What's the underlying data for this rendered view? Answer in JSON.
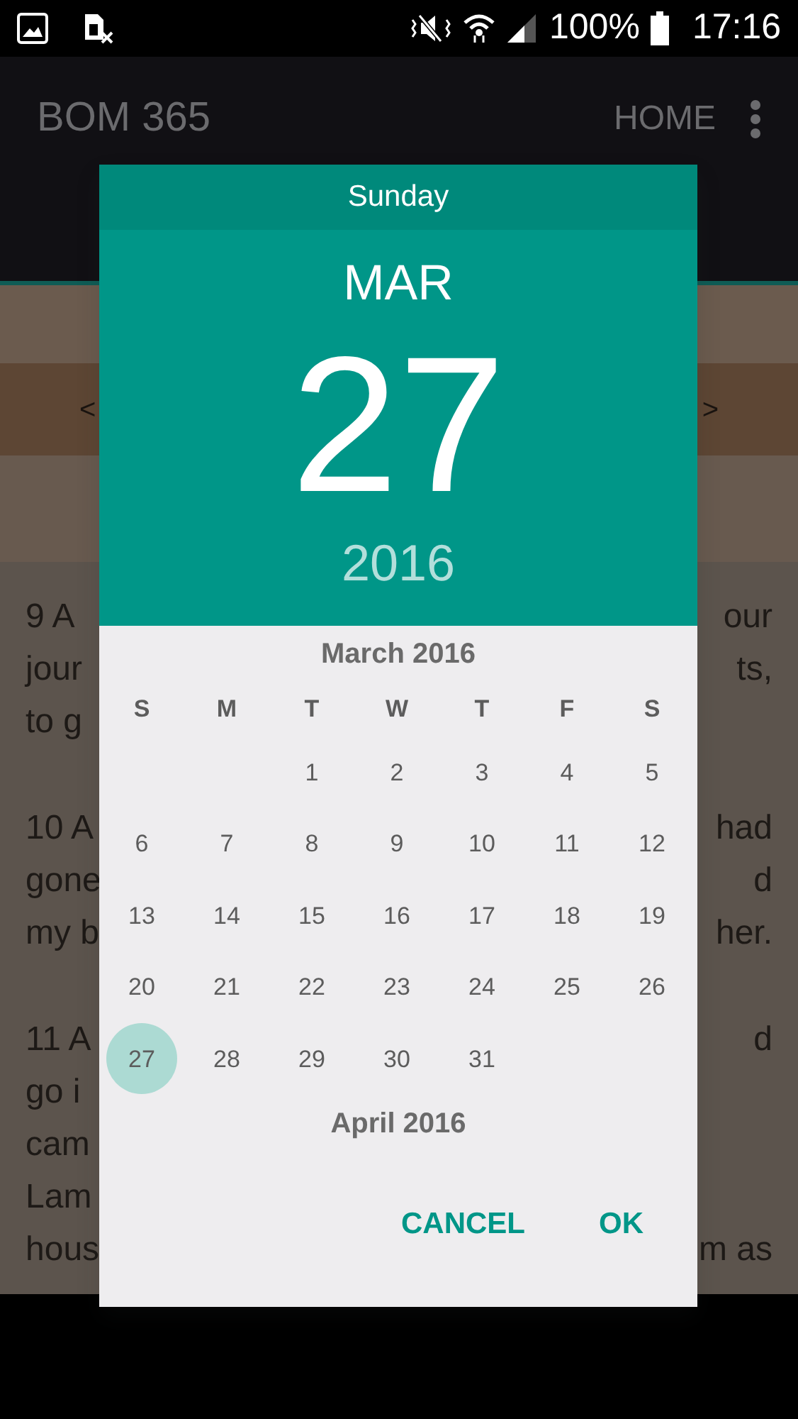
{
  "status_bar": {
    "battery": "100%",
    "time": "17:16"
  },
  "app_bar": {
    "title": "BOM 365",
    "action": "HOME"
  },
  "chapter_nav": {
    "previous": "<",
    "next": ">"
  },
  "background_text": [
    {
      "lines": [
        {
          "left": "9 A",
          "right": "our"
        },
        {
          "left": "jour",
          "right": "ts,"
        },
        {
          "left": "to g"
        }
      ]
    },
    {
      "lines": [
        {
          "left": "10 A",
          "right": "had"
        },
        {
          "left": "gone",
          "right": "d"
        },
        {
          "left": "my b",
          "right": "her."
        }
      ]
    },
    {
      "lines": [
        {
          "left": "11 A",
          "right": "d"
        },
        {
          "left": "go i"
        },
        {
          "left": "cam"
        },
        {
          "left": "Lam"
        },
        {
          "left": "hous",
          "right": "m as"
        }
      ]
    }
  ],
  "date_picker": {
    "weekday": "Sunday",
    "month": "MAR",
    "day": "27",
    "year": "2016",
    "months": [
      {
        "title": "March 2016",
        "weekdays": [
          "S",
          "M",
          "T",
          "W",
          "T",
          "F",
          "S"
        ],
        "weeks": [
          [
            {
              "label": "1",
              "selected": false
            },
            {
              "label": "2",
              "selected": false
            },
            {
              "label": "3",
              "selected": false
            },
            {
              "label": "4",
              "selected": false
            },
            {
              "label": "5",
              "selected": false
            }
          ],
          [
            {
              "label": "6",
              "selected": false
            },
            {
              "label": "7",
              "selected": false
            },
            {
              "label": "8",
              "selected": false
            },
            {
              "label": "9",
              "selected": false
            },
            {
              "label": "10",
              "selected": false
            },
            {
              "label": "11",
              "selected": false
            },
            {
              "label": "12",
              "selected": false
            }
          ],
          [
            {
              "label": "13",
              "selected": false
            },
            {
              "label": "14",
              "selected": false
            },
            {
              "label": "15",
              "selected": false
            },
            {
              "label": "16",
              "selected": false
            },
            {
              "label": "17",
              "selected": false
            },
            {
              "label": "18",
              "selected": false
            },
            {
              "label": "19",
              "selected": false
            }
          ],
          [
            {
              "label": "20",
              "selected": false
            },
            {
              "label": "21",
              "selected": false
            },
            {
              "label": "22",
              "selected": false
            },
            {
              "label": "23",
              "selected": false
            },
            {
              "label": "24",
              "selected": false
            },
            {
              "label": "25",
              "selected": false
            },
            {
              "label": "26",
              "selected": false
            }
          ],
          [
            {
              "label": "27",
              "selected": true
            },
            {
              "label": "28",
              "selected": false
            },
            {
              "label": "29",
              "selected": false
            },
            {
              "label": "30",
              "selected": false
            },
            {
              "label": "31",
              "selected": false
            }
          ]
        ]
      },
      {
        "title": "April 2016"
      }
    ],
    "buttons": [
      "CANCEL",
      "OK"
    ]
  }
}
